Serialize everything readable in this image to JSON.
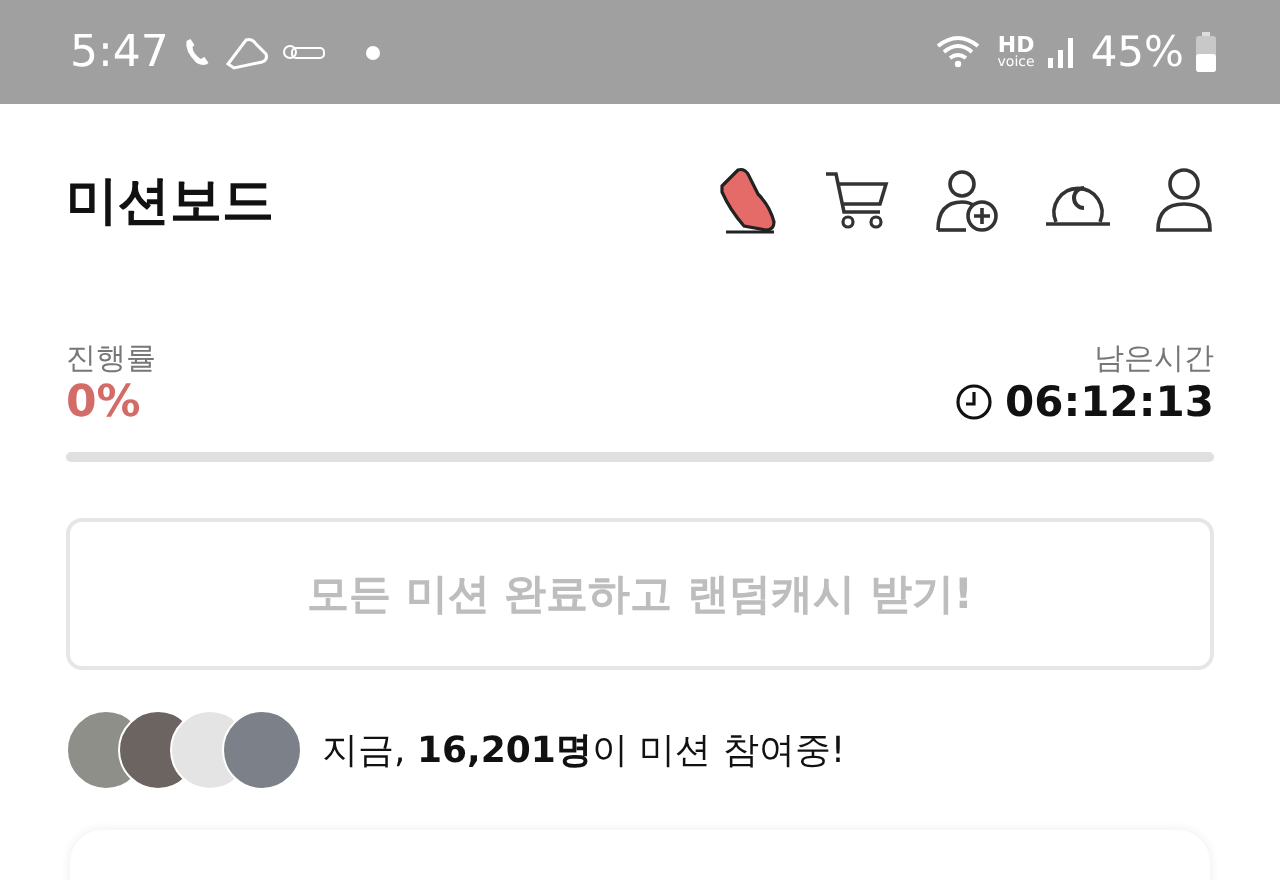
{
  "status_bar": {
    "time": "5:47",
    "hd": "HD",
    "voice": "voice",
    "battery": "45%"
  },
  "header": {
    "title": "미션보드"
  },
  "progress": {
    "label": "진행률",
    "value": "0%",
    "level": 0,
    "time_label": "남은시간",
    "time": "06:12:13"
  },
  "reward_button": {
    "label": "모든 미션 완료하고 랜덤캐시 받기!",
    "disabled": true
  },
  "participants": {
    "text": "지금, **16,201명**이 미션 참여중!"
  }
}
